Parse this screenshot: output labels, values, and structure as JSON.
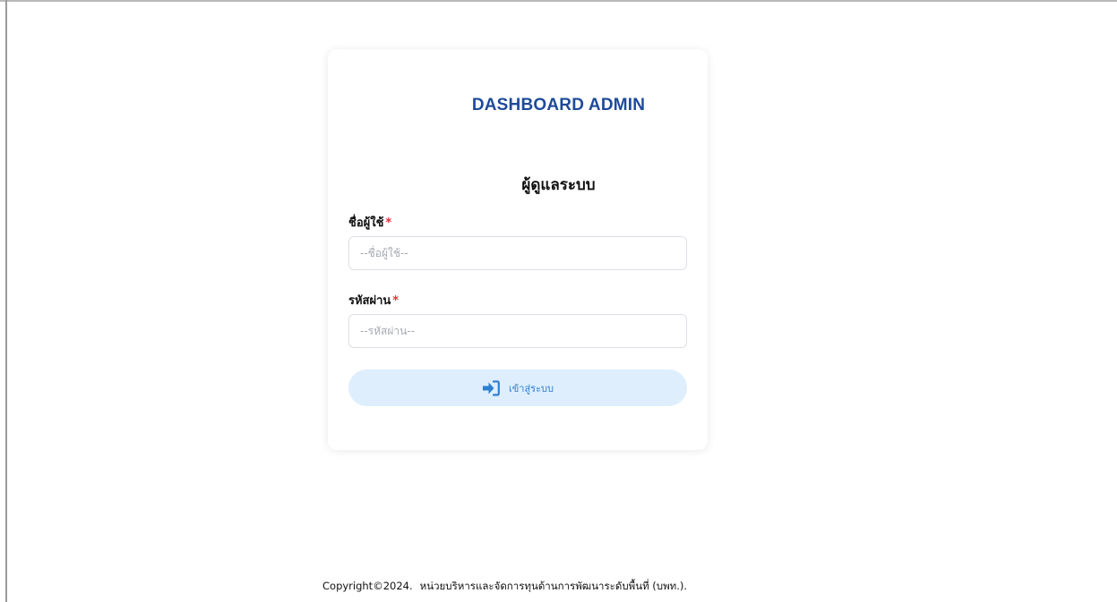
{
  "app": {
    "title": "DASHBOARD ADMIN"
  },
  "login_form": {
    "heading": "ผู้ดูแลระบบ",
    "username": {
      "label": "ชื่อผู้ใช้",
      "required_mark": "*",
      "value": "",
      "placeholder": "--ชื่อผู้ใช้--"
    },
    "password": {
      "label": "รหัสผ่าน",
      "required_mark": "*",
      "value": "",
      "placeholder": "--รหัสผ่าน--"
    },
    "submit": {
      "label": "เข้าสู่ระบบ",
      "icon": "sign-in-icon"
    }
  },
  "footer": {
    "copyright": "Copyright©2024.",
    "organization": "หน่วยบริหารและจัดการทุนด้านการพัฒนาระดับพื้นที่ (บพท.)."
  },
  "colors": {
    "title": "#1e4a9a",
    "required": "#e0313b",
    "button_bg": "#deeefd",
    "button_fg": "#2f7fd1"
  }
}
